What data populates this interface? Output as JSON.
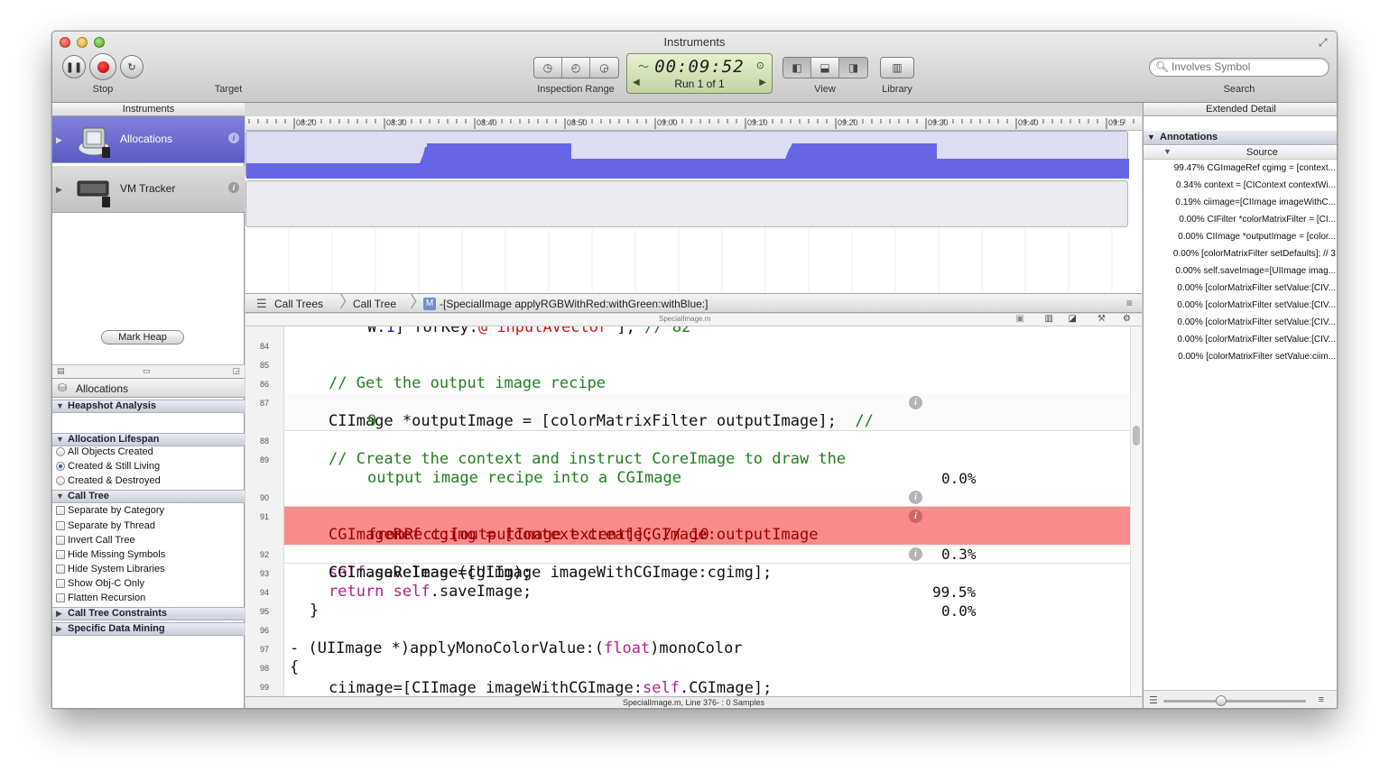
{
  "window": {
    "title": "Instruments"
  },
  "toolbar": {
    "stop_label": "Stop",
    "target_label": "Target",
    "inspection_label": "Inspection Range",
    "timer": "00:09:52",
    "run_label": "Run 1 of 1",
    "view_label": "View",
    "library_label": "Library",
    "search_label": "Search",
    "search_placeholder": "Involves Symbol"
  },
  "headers": {
    "instruments": "Instruments",
    "extended_detail": "Extended Detail"
  },
  "ruler_ticks": [
    "08:20",
    "08:30",
    "08:40",
    "08:50",
    "09:00",
    "09:10",
    "09:20",
    "09:30",
    "09:40",
    "09:5"
  ],
  "tracks": [
    {
      "name": "Allocations"
    },
    {
      "name": "VM Tracker"
    }
  ],
  "left_nav": {
    "title": "Allocations"
  },
  "sections": {
    "heapshot": "Heapshot Analysis",
    "mark_heap": "Mark Heap",
    "lifespan": "Allocation Lifespan",
    "lifespan_opts": [
      "All Objects Created",
      "Created & Still Living",
      "Created & Destroyed"
    ],
    "lifespan_selected": 1,
    "calltree": "Call Tree",
    "calltree_opts": [
      "Separate by Category",
      "Separate by Thread",
      "Invert Call Tree",
      "Hide Missing Symbols",
      "Hide System Libraries",
      "Show Obj-C Only",
      "Flatten Recursion"
    ],
    "constraints": "Call Tree Constraints",
    "mining": "Specific Data Mining"
  },
  "breadcrumb": {
    "c1": "Call Trees",
    "c2": "Call Tree",
    "c3": "-[SpecialImage applyRGBWithRed:withGreen:withBlue:]",
    "file": "SpecialImage.m"
  },
  "code": {
    "line_numbers": [
      "84",
      "85",
      "86",
      "87",
      "88",
      "89",
      "90",
      "91",
      "92",
      "93",
      "94",
      "95",
      "96",
      "97",
      "98",
      "99"
    ],
    "pct": {
      "l87": "0.0%",
      "l90": "0.3%",
      "l91": "99.5%",
      "l92": "0.0%"
    }
  },
  "status": "SpecialImage.m, Line 376- : 0 Samples",
  "annotations": {
    "header": "Annotations",
    "source_header": "Source",
    "rows": [
      "99.47% CGImageRef cgimg = [context...",
      "0.34% context = [CIContext contextWi...",
      "0.19% ciimage=[CIImage imageWithC...",
      "0.00% CIFilter *colorMatrixFilter = [CI...",
      "0.00% CIImage *outputImage = [color...",
      "0.00% [colorMatrixFilter setDefaults]; // 3",
      "0.00% self.saveImage=[UIImage imag...",
      "0.00% [colorMatrixFilter setValue:[CIV...",
      "0.00% [colorMatrixFilter setValue:[CIV...",
      "0.00% [colorMatrixFilter setValue:[CIV...",
      "0.00% [colorMatrixFilter setValue:[CIV...",
      "0.00% [colorMatrixFilter setValue:ciim..."
    ]
  },
  "colors": {
    "graph_fill": "#6565e6",
    "highlight": "#fb8a8a"
  }
}
